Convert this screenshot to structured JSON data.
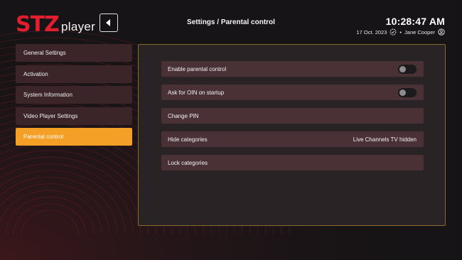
{
  "brand": {
    "logo_letters": "STZ",
    "logo_word": "player"
  },
  "header": {
    "title": "Settings / Parental control",
    "time": "10:28:47 AM",
    "date": "17 Oct. 2023",
    "user": "Jane Cooper"
  },
  "sidebar": {
    "items": [
      {
        "label": "General Settings",
        "active": false
      },
      {
        "label": "Activation",
        "active": false
      },
      {
        "label": "System Information",
        "active": false
      },
      {
        "label": "Video Player Settings",
        "active": false
      },
      {
        "label": "Parental control",
        "active": true
      }
    ]
  },
  "parental": {
    "rows": [
      {
        "label": "Enable parental control",
        "type": "toggle",
        "on": false
      },
      {
        "label": "Ask for OIN on startup",
        "type": "toggle",
        "on": false
      },
      {
        "label": "Change PIN",
        "type": "link"
      },
      {
        "label": "Hide categories",
        "type": "value",
        "value": "Live Channels TV hidden"
      },
      {
        "label": "Lock categories",
        "type": "link"
      }
    ]
  },
  "colors": {
    "accent": "#f4a026",
    "brand_red": "#e01e2d",
    "item_bg": "#3b2528",
    "row_bg": "#4a3136",
    "panel_bg": "#2a2326",
    "panel_border": "#8a6a2c"
  },
  "icons": {
    "back": "back-arrow-icon",
    "verified": "verified-badge-icon",
    "user": "user-circle-icon"
  }
}
